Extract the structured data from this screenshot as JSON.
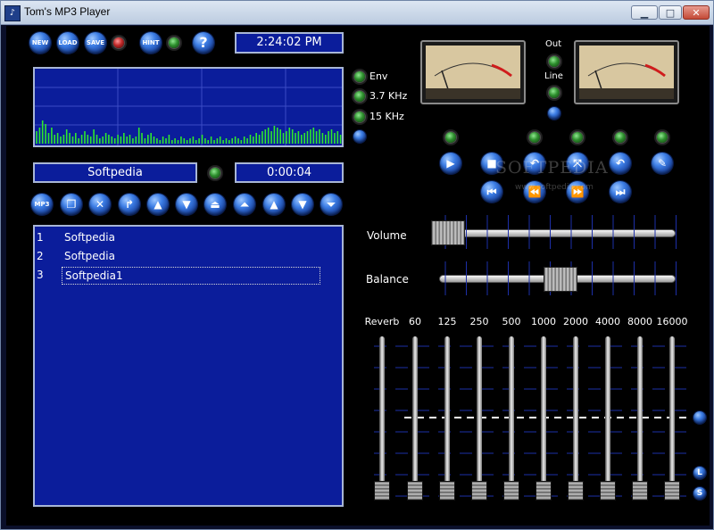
{
  "window": {
    "title": "Tom's MP3 Player",
    "minimize": "▁",
    "maximize": "□",
    "close": "✕",
    "app_icon": "♪"
  },
  "top_buttons": {
    "new": "NEW",
    "load": "LOAD",
    "save": "SAVE",
    "hint": "HINT",
    "help": "?"
  },
  "clock": "2:24:02 PM",
  "spectrum_options": {
    "env": "Env",
    "khz37": "3.7 KHz",
    "khz15": "15 KHz"
  },
  "spectrum_bars": [
    14,
    18,
    26,
    22,
    12,
    18,
    10,
    12,
    8,
    10,
    16,
    12,
    8,
    12,
    6,
    10,
    14,
    10,
    8,
    16,
    10,
    6,
    8,
    12,
    10,
    8,
    6,
    10,
    8,
    12,
    8,
    10,
    6,
    8,
    18,
    12,
    6,
    10,
    12,
    8,
    6,
    4,
    8,
    6,
    10,
    4,
    6,
    4,
    8,
    6,
    4,
    6,
    8,
    4,
    6,
    10,
    6,
    4,
    8,
    4,
    6,
    8,
    4,
    6,
    4,
    6,
    8,
    6,
    4,
    8,
    6,
    10,
    8,
    12,
    10,
    14,
    16,
    18,
    14,
    20,
    18,
    16,
    12,
    14,
    18,
    16,
    12,
    14,
    10,
    12,
    14,
    16,
    18,
    14,
    16,
    12,
    10,
    14,
    16,
    12,
    14,
    10
  ],
  "track": {
    "name": "Softpedia",
    "time": "0:00:04"
  },
  "playlist_buttons": [
    "MP3",
    "copy-icon",
    "delete-icon",
    "export-icon",
    "sort-asc-icon",
    "filter-icon",
    "eject-icon",
    "move-top-icon",
    "move-up-icon",
    "move-down-icon",
    "move-bottom-icon"
  ],
  "playlist": [
    {
      "num": "1",
      "name": "Softpedia"
    },
    {
      "num": "2",
      "name": "Softpedia"
    },
    {
      "num": "3",
      "name": "Softpedia1"
    }
  ],
  "vu": {
    "out_label": "Out",
    "line_label": "Line",
    "scale": [
      "20",
      "10",
      "7",
      "5",
      "3",
      "1",
      "0",
      "1",
      "2",
      "3"
    ]
  },
  "transport": {
    "play": "▶",
    "stop": "■",
    "prev_mark": "↶",
    "mark": "⤧",
    "loop": "↶",
    "edit": "✎",
    "rewind": "⏮",
    "back": "⏪",
    "forward": "⏩",
    "next": "⏭"
  },
  "volume": {
    "label": "Volume",
    "level": 0.0
  },
  "balance": {
    "label": "Balance",
    "level": 0.5
  },
  "equalizer": {
    "labels": [
      "Reverb",
      "60",
      "125",
      "250",
      "500",
      "1000",
      "2000",
      "4000",
      "8000",
      "16000"
    ],
    "levels": [
      0,
      0,
      0,
      0,
      0,
      0,
      0,
      0,
      0,
      0
    ],
    "side_l": "L",
    "side_s": "S"
  },
  "watermark": {
    "brand": "SOFTPEDIA",
    "url": "www.softpedia.com"
  },
  "colors": {
    "lcd_blue": "#0b1d9b",
    "spectrum_green": "#2ee82e",
    "button_blue": "#3d7ee6",
    "led_green": "#2e8f2e",
    "led_red": "#c02828"
  }
}
